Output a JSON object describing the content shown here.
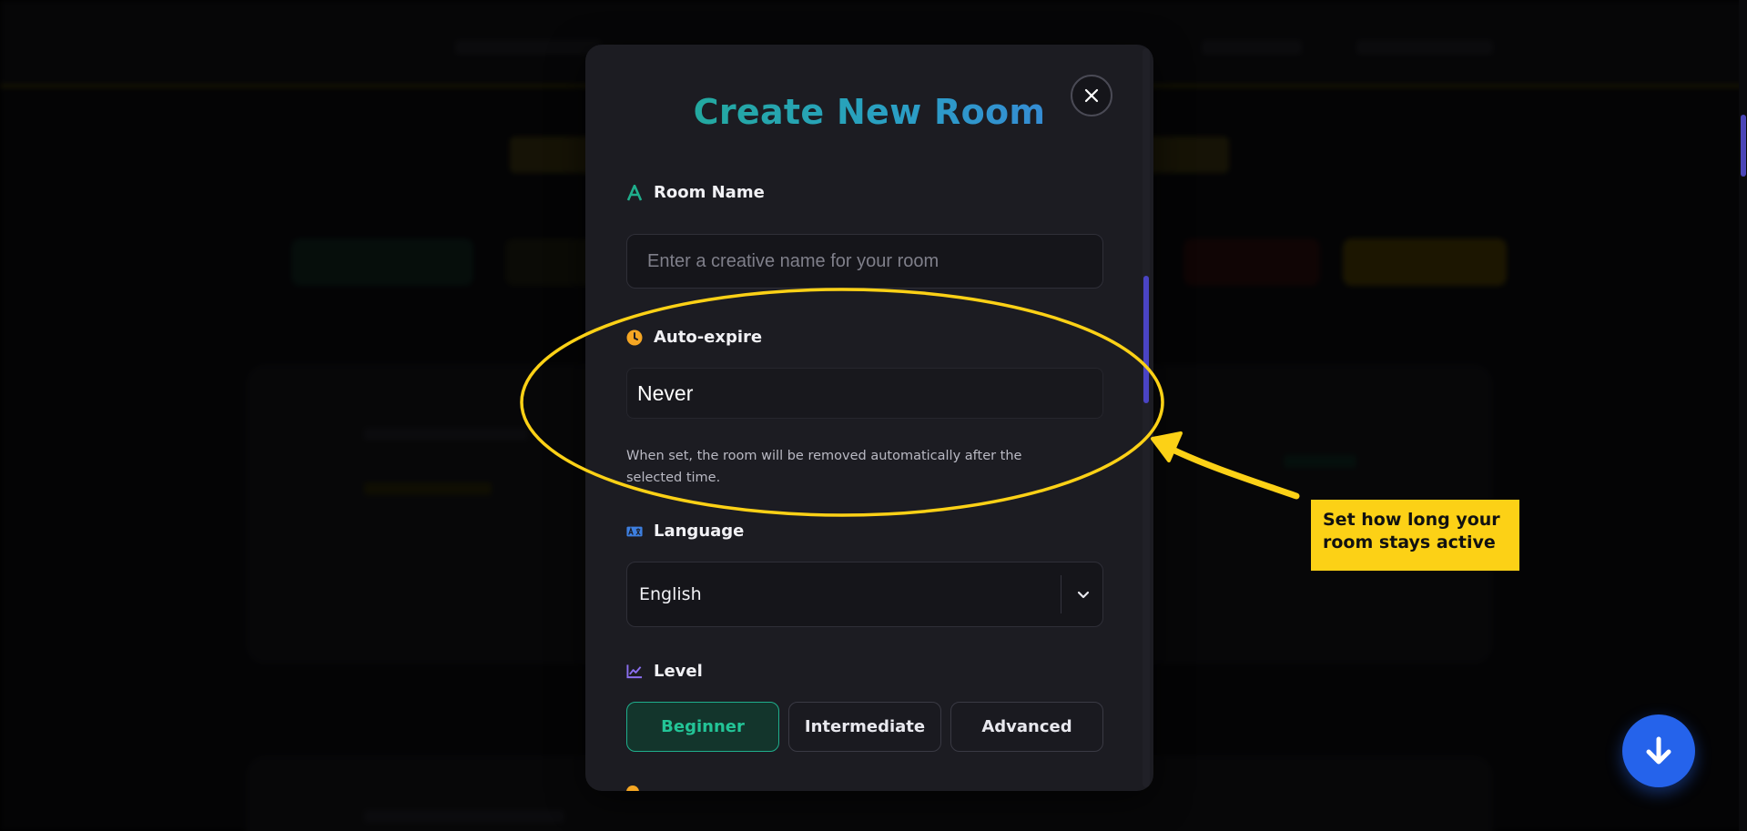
{
  "modal": {
    "title": "Create New Room",
    "close_icon": "close-icon",
    "room_name": {
      "label": "Room Name",
      "icon": "letter-a-icon",
      "placeholder": "Enter a creative name for your room",
      "value": ""
    },
    "auto_expire": {
      "label": "Auto-expire",
      "icon": "clock-icon",
      "value": "Never",
      "helper": "When set, the room will be removed automatically after the selected time."
    },
    "language": {
      "label": "Language",
      "icon": "translate-icon",
      "selected": "English",
      "chevron_icon": "chevron-down-icon"
    },
    "level": {
      "label": "Level",
      "icon": "chart-line-icon",
      "options": [
        "Beginner",
        "Intermediate",
        "Advanced"
      ],
      "selected": "Beginner"
    }
  },
  "annotation": {
    "callout_text": "Set how long your room stays active"
  },
  "scroll_button": {
    "icon": "arrow-down-icon"
  },
  "colors": {
    "accent_teal": "#1fae8c",
    "accent_blue": "#3d7fe0",
    "callout_yellow": "#fcd116",
    "fab_blue": "#2563eb",
    "clock_orange": "#f5a623"
  }
}
